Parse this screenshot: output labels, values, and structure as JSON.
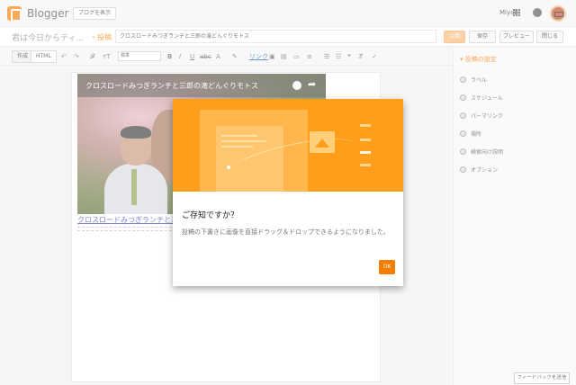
{
  "header": {
    "brand": "Blogger",
    "view_blog_label": "ブログを表示",
    "user_name": "Miyabi"
  },
  "titlebar": {
    "blog_name": "君は今日からティ...",
    "crumb": "・投稿",
    "post_title": "クロスロードみつぎランチと三郎の滝どんぐりモトス",
    "publish_label": "公開",
    "save_label": "保存",
    "preview_label": "プレビュー",
    "close_label": "閉じる"
  },
  "toolbar": {
    "compose_label": "作成",
    "html_label": "HTML",
    "font_value": "標準",
    "link_label": "リンク"
  },
  "editor": {
    "video_title": "クロスロードみつぎランチと三郎の滝どんぐりモトス",
    "link_text": "クロスロードみつぎランチと三"
  },
  "sidebar": {
    "heading": "投稿の設定",
    "items": [
      {
        "label": "ラベル",
        "icon": "label-icon"
      },
      {
        "label": "スケジュール",
        "icon": "clock-icon"
      },
      {
        "label": "パーマリンク",
        "icon": "link-icon"
      },
      {
        "label": "場所",
        "icon": "location-icon"
      },
      {
        "label": "検索向け説明",
        "icon": "search-icon"
      },
      {
        "label": "オプション",
        "icon": "gear-icon"
      }
    ]
  },
  "feedback_label": "フィードバックを送信",
  "dialog": {
    "title": "ご存知ですか？",
    "text": "投稿の下書きに画像を直接ドラッグ＆ドロップできるようになりました。",
    "ok_label": "OK"
  },
  "colors": {
    "accent": "#f57d00",
    "dialog_art": "#ff9e1a"
  }
}
